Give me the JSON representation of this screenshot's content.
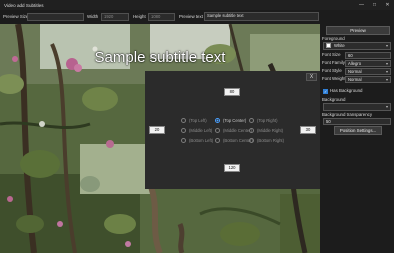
{
  "window": {
    "title": "Video add Subtitles",
    "minimize_icon": "minimize-icon",
    "maximize_icon": "maximize-icon",
    "close_icon": "close-icon"
  },
  "toolbar": {
    "preview_size_label": "Preview Size",
    "preview_size_value": "",
    "width_label": "Width",
    "width_value": "1920",
    "height_label": "Height",
    "height_value": "1080",
    "preview_text_label": "Preview text",
    "preview_text_value": "Sample subtitle text"
  },
  "preview": {
    "subtitle_text": "Sample subtitle text"
  },
  "position_dialog": {
    "top_value": "80",
    "left_value": "20",
    "right_value": "30",
    "bottom_value": "120",
    "options": [
      {
        "label": "(Top Left)",
        "selected": false
      },
      {
        "label": "(Top Center)",
        "selected": true
      },
      {
        "label": "(Top Right)",
        "selected": false
      },
      {
        "label": "(Middle Left)",
        "selected": false
      },
      {
        "label": "(Middle Center)",
        "selected": false
      },
      {
        "label": "(Middle Right)",
        "selected": false
      },
      {
        "label": "(Bottom Left)",
        "selected": false
      },
      {
        "label": "(Bottom Center)",
        "selected": false
      },
      {
        "label": "(Bottom Right)",
        "selected": false
      }
    ],
    "close_label": "X"
  },
  "sidebar": {
    "preview_button": "Preview",
    "foreground_label": "Foreground",
    "foreground_color_name": "White",
    "font_size_label": "Font Size",
    "font_size_value": "60",
    "font_family_label": "Font Family",
    "font_family_value": "Allegro",
    "font_style_label": "Font Style",
    "font_style_value": "Normal",
    "font_weight_label": "Font Weight",
    "font_weight_value": "Normal",
    "has_background_label": "Has Background",
    "has_background_checked": true,
    "background_label": "Background",
    "background_value": "",
    "background_transparency_label": "Background transparency",
    "background_transparency_value": "50",
    "position_settings_button": "Position Settings..."
  },
  "colors": {
    "accent": "#2f7fd6",
    "foreground_swatch": "#ffffff"
  }
}
